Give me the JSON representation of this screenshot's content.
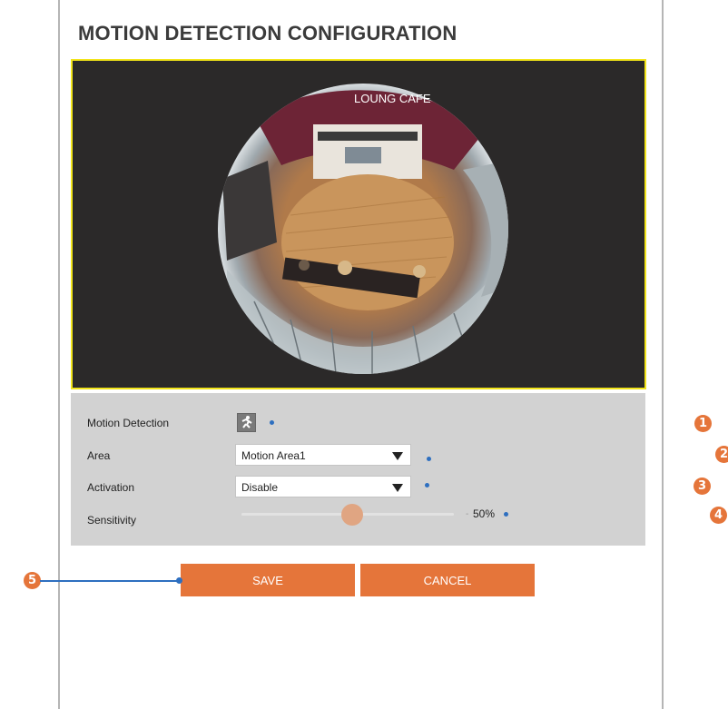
{
  "header": {
    "title": "MOTION DETECTION CONFIGURATION"
  },
  "video": {
    "overlay_text": "LOUNG CAFE",
    "border_color": "#f2e41a"
  },
  "settings": {
    "motion_detection": {
      "label": "Motion Detection",
      "icon": "running-person-icon"
    },
    "area": {
      "label": "Area",
      "value": "Motion Area1"
    },
    "activation": {
      "label": "Activation",
      "value": "Disable"
    },
    "sensitivity": {
      "label": "Sensitivity",
      "value_text": "50%",
      "value": 0.5
    }
  },
  "buttons": {
    "save_label": "SAVE",
    "cancel_label": "CANCEL"
  },
  "callouts": [
    "1",
    "2",
    "3",
    "4",
    "5"
  ],
  "colors": {
    "accent": "#e5753a",
    "marker": "#2e6fc0",
    "panel": "#d2d2d2"
  }
}
